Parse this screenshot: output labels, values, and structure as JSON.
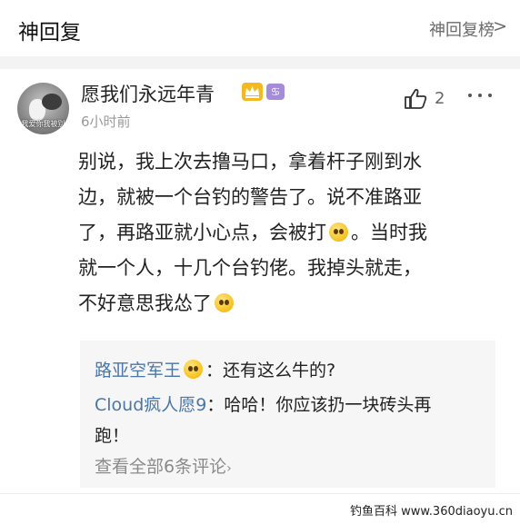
{
  "header": {
    "title": "神回复",
    "link_label": "神回复榜",
    "chevron": ">"
  },
  "post": {
    "avatar_caption": "我爱你我被别",
    "username": "愿我们永远年青",
    "badges": {
      "crown": "",
      "zodiac": "♋"
    },
    "time": "6小时前",
    "like_count": "2",
    "body_lines": [
      "别说，我上次去撸马口，拿着杆子刚到水",
      "边，就被一个台钓的警告了。说不准路亚",
      "了，再路亚就小心点，会被打",
      "。当时我",
      "就一个人，十几个台钓佬。我掉头就走，",
      "不好意思我怂了"
    ]
  },
  "replies": [
    {
      "author": "路亚空军王",
      "text": "：还有这么牛的?"
    },
    {
      "author": "Cloud疯人愿9",
      "text": "：哈哈！你应该扔一块砖头再",
      "text_cont": "跑！"
    }
  ],
  "view_all": "查看全部6条评论",
  "view_all_arrow": "›",
  "watermark": "钓鱼百科 www.360diaoyu.cn",
  "colors": {
    "link": "#4a76a8",
    "reply_bg": "#f6f6f6",
    "badge_gold": "#f4b821",
    "badge_purple": "#a58cd9"
  },
  "icons": {
    "like": "thumbs-up-outline-icon",
    "more": "three-dots-icon",
    "emoji": "squinting-face-emoji"
  }
}
